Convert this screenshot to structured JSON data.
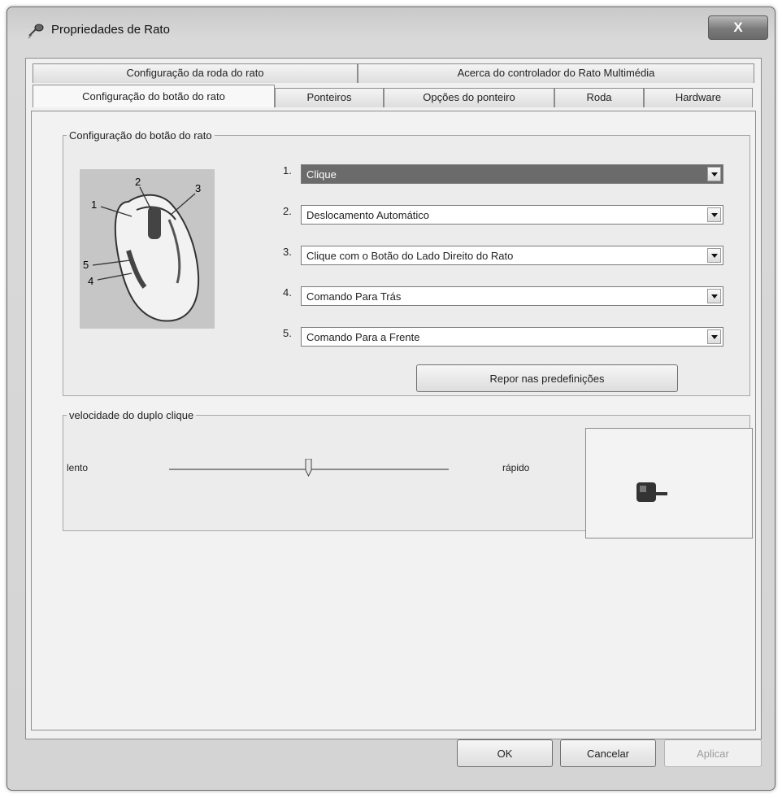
{
  "window": {
    "title": "Propriedades de Rato",
    "close_label": "X"
  },
  "tabs": {
    "row1": [
      {
        "label": "Configuração da roda do rato"
      },
      {
        "label": "Acerca do controlador do Rato Multimédia"
      }
    ],
    "row2": [
      {
        "label": "Configuração do botão do rato",
        "active": true
      },
      {
        "label": "Ponteiros"
      },
      {
        "label": "Opções do ponteiro"
      },
      {
        "label": "Roda"
      },
      {
        "label": "Hardware"
      }
    ]
  },
  "button_config": {
    "legend": "Configuração do botão do rato",
    "mouse_callouts": [
      "1",
      "2",
      "3",
      "4",
      "5"
    ],
    "assignments": [
      {
        "number": "1.",
        "value": "Clique",
        "selected": true
      },
      {
        "number": "2.",
        "value": "Deslocamento Automático"
      },
      {
        "number": "3.",
        "value": "Clique com o Botão do Lado Direito do Rato"
      },
      {
        "number": "4.",
        "value": "Comando Para Trás"
      },
      {
        "number": "5.",
        "value": "Comando Para a Frente"
      }
    ],
    "reset_label": "Repor nas predefinições"
  },
  "double_click": {
    "legend": "velocidade do duplo clique",
    "slow_label": "lento",
    "fast_label": "rápido",
    "speed_fraction": 0.5
  },
  "buttons": {
    "ok": "OK",
    "cancel": "Cancelar",
    "apply": "Aplicar"
  }
}
